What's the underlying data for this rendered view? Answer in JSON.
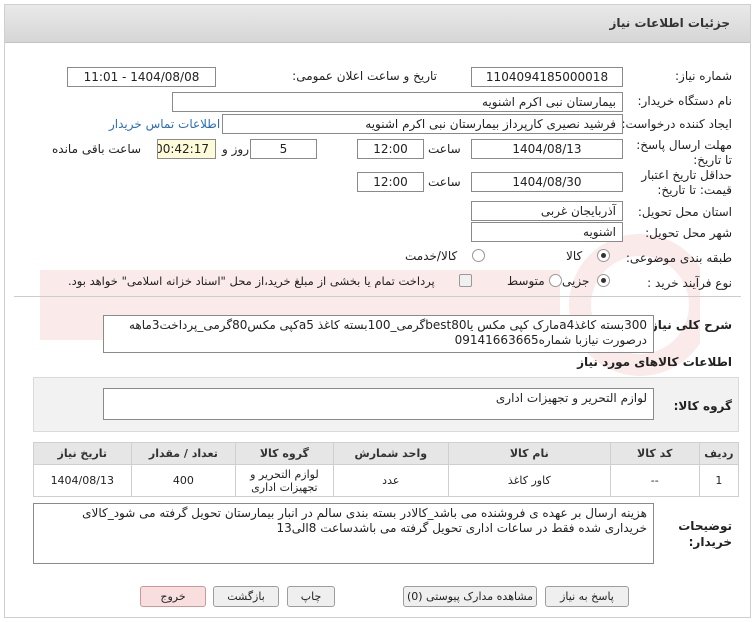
{
  "header": {
    "title": "جزئیات اطلاعات نیاز"
  },
  "fields": {
    "need_number_label": "شماره نیاز:",
    "need_number": "1104094185000018",
    "announce_label": "تاریخ و ساعت اعلان عمومی:",
    "announce_value": "1404/08/08 - 11:01",
    "buyer_org_label": "نام دستگاه خریدار:",
    "buyer_org": "بیمارستان نبی اکرم اشنویه",
    "creator_label": "ایجاد کننده درخواست:",
    "creator": "فرشید نصیری کارپرداز بیمارستان نبی اکرم اشنویه",
    "contact_link": "اطلاعات تماس خریدار",
    "deadline_label": "مهلت ارسال پاسخ: تا تاریخ:",
    "deadline_date": "1404/08/13",
    "time_label": "ساعت",
    "deadline_time": "12:00",
    "days_value": "5",
    "days_label": "روز و",
    "remaining_time": "00:42:17",
    "remaining_label": "ساعت باقی مانده",
    "validity_label": "حداقل تاریخ اعتبار قیمت: تا تاریخ:",
    "validity_date": "1404/08/30",
    "validity_time": "12:00",
    "province_label": "استان محل تحویل:",
    "province": "آذربایجان غربی",
    "city_label": "شهر محل تحویل:",
    "city": "اشنویه",
    "category_label": "طبقه بندی موضوعی:",
    "category_opt1": "کالا",
    "category_opt2": "کالا/خدمت",
    "process_label": "نوع فرآیند خرید :",
    "process_opt1": "جزیی",
    "process_opt2": "متوسط",
    "payment_note": "پرداخت تمام یا بخشی از مبلغ خرید،از محل \"اسناد خزانه اسلامی\" خواهد بود."
  },
  "description": {
    "label": "شرح کلی نیاز:",
    "text": "300بسته کاغذa4مارک کپی مکس یاbest80گرمی_100بسته کاغذ a5کپی مکس80گرمی_پرداخت3ماهه درصورت نیازبا شماره09141663665"
  },
  "goods": {
    "section_title": "اطلاعات کالاهای مورد نیاز",
    "group_label": "گروه کالا:",
    "group_value": "لوازم التحریر و تجهیزات اداری"
  },
  "table": {
    "headers": [
      "ردیف",
      "کد کالا",
      "نام کالا",
      "واحد شمارش",
      "گروه کالا",
      "تعداد / مقدار",
      "تاریخ نیاز"
    ],
    "rows": [
      [
        "1",
        "--",
        "کاور کاغذ",
        "عدد",
        "لوازم التحریر و تجهیزات اداری",
        "400",
        "1404/08/13"
      ]
    ]
  },
  "buyer_notes": {
    "label": "توضیحات خریدار:",
    "text": "هزینه ارسال بر عهده ی فروشنده می باشد_کالادر بسته بندی سالم در انبار بیمارستان تحویل گرفته می شود_کالای خریداری شده فقط در ساعات اداری تحویل گرفته می باشدساعت 8الی13"
  },
  "buttons": {
    "reply": "پاسخ به نیاز",
    "attachments": "مشاهده مدارک پیوستی (0)",
    "print": "چاپ",
    "back": "بازگشت",
    "exit": "خروج"
  }
}
